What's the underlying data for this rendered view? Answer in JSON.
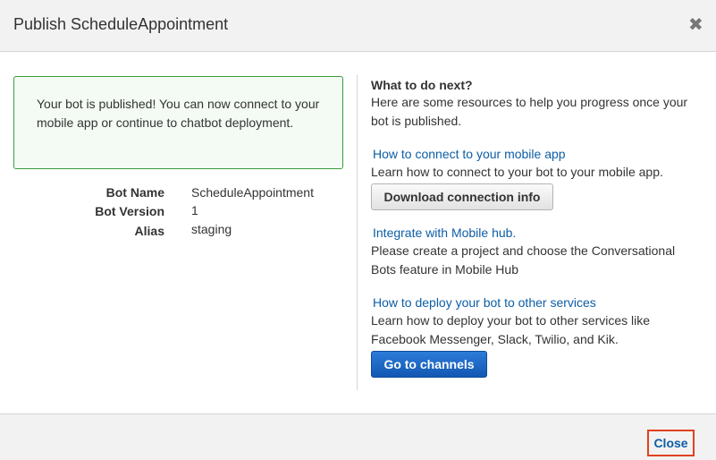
{
  "dialog": {
    "title": "Publish ScheduleAppointment",
    "close_icon": "close-icon"
  },
  "success": {
    "message": "Your bot is published! You can now connect to your mobile app or continue to chatbot deployment."
  },
  "details": [
    {
      "label": "Bot Name",
      "value": "ScheduleAppointment"
    },
    {
      "label": "Bot Version",
      "value": "1"
    },
    {
      "label": "Alias",
      "value": "staging"
    }
  ],
  "next": {
    "heading": "What to do next?",
    "intro": "Here are some resources to help you progress once your bot is published.",
    "mobile_link": "How to connect to your mobile app",
    "mobile_desc": "Learn how to connect to your bot to your mobile app.",
    "download_button": "Download connection info",
    "hub_link": "Integrate with Mobile hub.",
    "hub_desc": "Please create a project and choose the Conversational Bots feature in Mobile Hub",
    "deploy_link": "How to deploy your bot to other services",
    "deploy_desc": "Learn how to deploy your bot to other services like Facebook Messenger, Slack, Twilio, and Kik.",
    "channels_button": "Go to channels"
  },
  "footer": {
    "close_label": "Close"
  },
  "colors": {
    "link": "#0d5ea6",
    "primary": "#1a66c4",
    "success_border": "#3c9c3c",
    "close_highlight": "#e0421f"
  }
}
